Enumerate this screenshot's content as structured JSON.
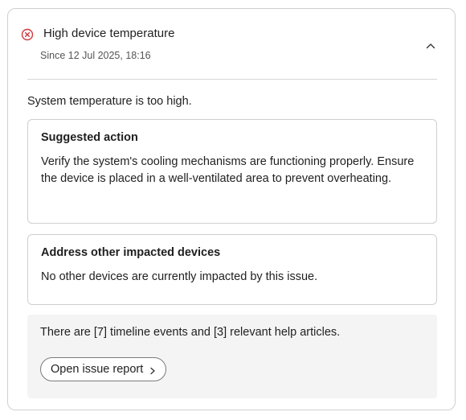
{
  "alert": {
    "title": "High device temperature",
    "since": "Since 12 Jul 2025, 18:16",
    "status_color": "#d0393e",
    "status_icon": "error-circle-icon",
    "collapse_icon": "chevron-up-icon",
    "description": "System temperature is too high."
  },
  "suggested_action": {
    "title": "Suggested action",
    "text": "Verify the system's cooling mechanisms are functioning properly. Ensure the device is placed in a well-ventilated area to prevent overheating."
  },
  "other_devices": {
    "title": "Address other impacted devices",
    "text": "No other devices are currently impacted by this issue."
  },
  "footer": {
    "text": "There are [7] timeline events and [3] relevant help articles.",
    "button_label": "Open issue report",
    "button_icon": "chevron-right-icon"
  }
}
